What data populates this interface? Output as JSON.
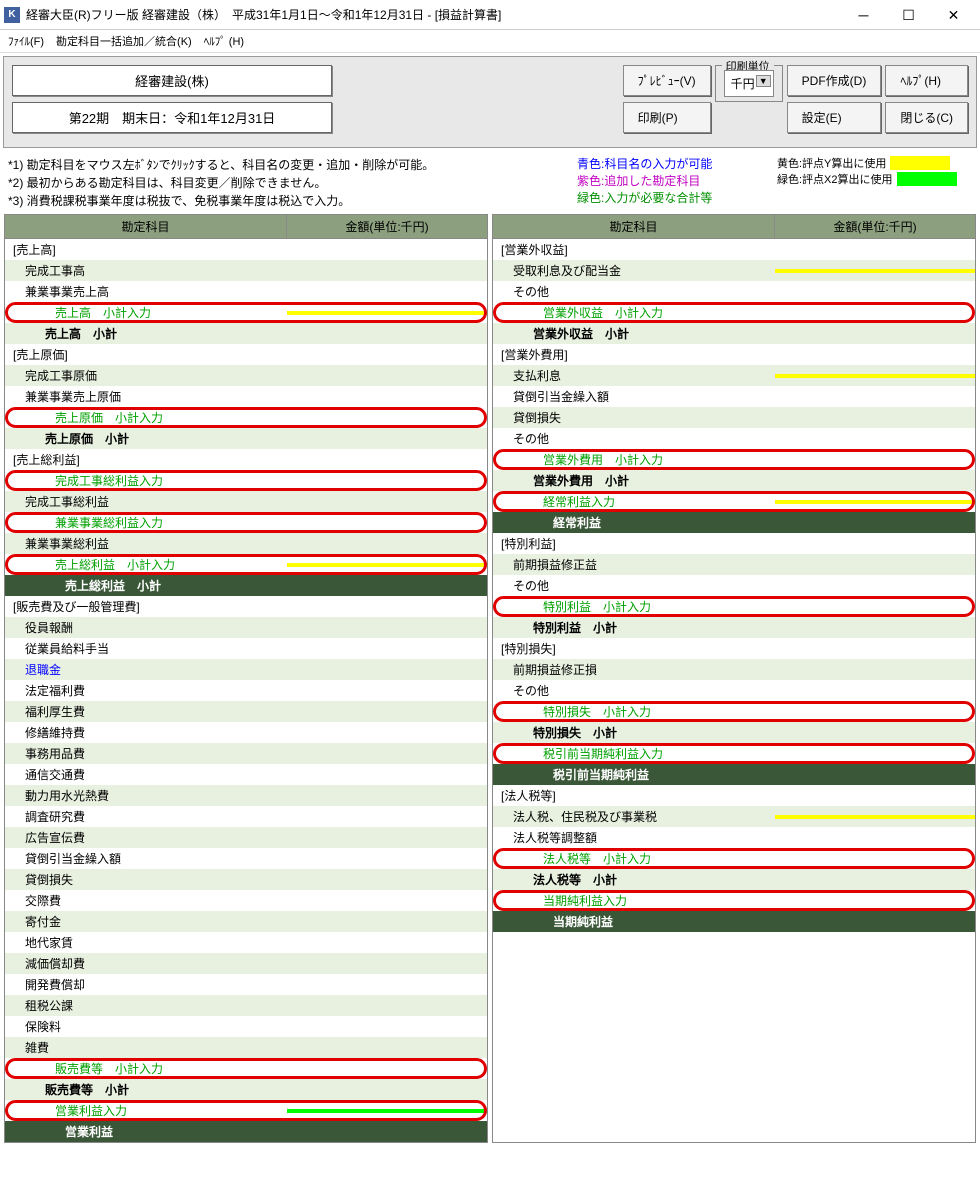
{
  "window": {
    "icon": "K",
    "title": "経審大臣(R)フリー版  経審建設（株）　平成31年1月1日～令和1年12月31日 - [損益計算書]"
  },
  "menu": {
    "file": "ﾌｧｲﾙ(F)",
    "addMerge": "勘定科目一括追加／統合(K)",
    "help": "ﾍﾙﾌﾟ (H)"
  },
  "info": {
    "company": "経審建設(株)",
    "period": "第22期　期末日：令和1年12月31日"
  },
  "buttons": {
    "preview": "ﾌﾟﾚﾋﾞｭｰ(V)",
    "print": "印刷(P)",
    "pdf": "PDF作成(D)",
    "settings": "設定(E)",
    "help": "ﾍﾙﾌﾟ(H)",
    "close": "閉じる(C)"
  },
  "unit": {
    "label": "印刷単位",
    "value": "千円"
  },
  "notes": {
    "n1": "*1) 勘定科目をマウス左ﾎﾞﾀﾝでｸﾘｯｸすると、科目名の変更・追加・削除が可能。",
    "n2": "*2) 最初からある勘定科目は、科目変更／削除できません。",
    "n3": "*3) 消費税課税事業年度は税抜で、免税事業年度は税込で入力。",
    "blue": "青色:科目名の入力が可能",
    "purple": "紫色:追加した勘定科目",
    "green": "緑色:入力が必要な合計等",
    "yellowLbl": "黄色:評点Y算出に使用",
    "greenLbl": "緑色:評点X2算出に使用"
  },
  "headers": {
    "name": "勘定科目",
    "amt": "金額(単位:千円)"
  },
  "left": [
    {
      "t": "s",
      "txt": "[売上高]"
    },
    {
      "t": "i",
      "txt": "完成工事高",
      "alt": 1
    },
    {
      "t": "i",
      "txt": "兼業事業売上高"
    },
    {
      "t": "hl",
      "txt": "売上高　小計入力",
      "amt": "y"
    },
    {
      "t": "sub",
      "txt": "売上高　小計"
    },
    {
      "t": "s",
      "txt": "[売上原価]"
    },
    {
      "t": "i",
      "txt": "完成工事原価",
      "alt": 1
    },
    {
      "t": "i",
      "txt": "兼業事業売上原価"
    },
    {
      "t": "hl",
      "txt": "売上原価　小計入力"
    },
    {
      "t": "sub",
      "txt": "売上原価　小計"
    },
    {
      "t": "s",
      "txt": "[売上総利益]"
    },
    {
      "t": "hl",
      "txt": "完成工事総利益入力"
    },
    {
      "t": "i",
      "txt": "完成工事総利益",
      "alt": 1
    },
    {
      "t": "hl",
      "txt": "兼業事業総利益入力"
    },
    {
      "t": "i",
      "txt": "兼業事業総利益",
      "alt": 1
    },
    {
      "t": "hl",
      "txt": "売上総利益　小計入力",
      "amt": "y"
    },
    {
      "t": "dark",
      "txt": "売上総利益　小計"
    },
    {
      "t": "s",
      "txt": "[販売費及び一般管理費]"
    },
    {
      "t": "i",
      "txt": "役員報酬",
      "alt": 1
    },
    {
      "t": "i",
      "txt": "従業員給料手当"
    },
    {
      "t": "i",
      "txt": "退職金",
      "alt": 1,
      "cls": "txt-blue"
    },
    {
      "t": "i",
      "txt": "法定福利費"
    },
    {
      "t": "i",
      "txt": "福利厚生費",
      "alt": 1
    },
    {
      "t": "i",
      "txt": "修繕維持費"
    },
    {
      "t": "i",
      "txt": "事務用品費",
      "alt": 1
    },
    {
      "t": "i",
      "txt": "通信交通費"
    },
    {
      "t": "i",
      "txt": "動力用水光熱費",
      "alt": 1
    },
    {
      "t": "i",
      "txt": "調査研究費"
    },
    {
      "t": "i",
      "txt": "広告宣伝費",
      "alt": 1
    },
    {
      "t": "i",
      "txt": "貸倒引当金繰入額"
    },
    {
      "t": "i",
      "txt": "貸倒損失",
      "alt": 1
    },
    {
      "t": "i",
      "txt": "交際費"
    },
    {
      "t": "i",
      "txt": "寄付金",
      "alt": 1
    },
    {
      "t": "i",
      "txt": "地代家賃"
    },
    {
      "t": "i",
      "txt": "減価償却費",
      "alt": 1
    },
    {
      "t": "i",
      "txt": "開発費償却"
    },
    {
      "t": "i",
      "txt": "租税公課",
      "alt": 1
    },
    {
      "t": "i",
      "txt": "保険料"
    },
    {
      "t": "i",
      "txt": "雑費",
      "alt": 1
    },
    {
      "t": "hl",
      "txt": "販売費等　小計入力"
    },
    {
      "t": "sub",
      "txt": "販売費等　小計"
    },
    {
      "t": "hl",
      "txt": "営業利益入力",
      "amt": "g"
    },
    {
      "t": "dark",
      "txt": "営業利益"
    }
  ],
  "right": [
    {
      "t": "s",
      "txt": "[営業外収益]"
    },
    {
      "t": "i",
      "txt": "受取利息及び配当金",
      "alt": 1,
      "amt": "y"
    },
    {
      "t": "i",
      "txt": "その他"
    },
    {
      "t": "hl",
      "txt": "営業外収益　小計入力"
    },
    {
      "t": "sub",
      "txt": "営業外収益　小計"
    },
    {
      "t": "s",
      "txt": "[営業外費用]"
    },
    {
      "t": "i",
      "txt": "支払利息",
      "alt": 1,
      "amt": "y"
    },
    {
      "t": "i",
      "txt": "貸倒引当金繰入額"
    },
    {
      "t": "i",
      "txt": "貸倒損失",
      "alt": 1
    },
    {
      "t": "i",
      "txt": "その他"
    },
    {
      "t": "hl",
      "txt": "営業外費用　小計入力"
    },
    {
      "t": "sub",
      "txt": "営業外費用　小計"
    },
    {
      "t": "hl",
      "txt": "経常利益入力",
      "amt": "y"
    },
    {
      "t": "dark",
      "txt": "経常利益"
    },
    {
      "t": "s",
      "txt": "[特別利益]"
    },
    {
      "t": "i",
      "txt": "前期損益修正益",
      "alt": 1
    },
    {
      "t": "i",
      "txt": "その他"
    },
    {
      "t": "hl",
      "txt": "特別利益　小計入力"
    },
    {
      "t": "sub",
      "txt": "特別利益　小計"
    },
    {
      "t": "s",
      "txt": "[特別損失]"
    },
    {
      "t": "i",
      "txt": "前期損益修正損",
      "alt": 1
    },
    {
      "t": "i",
      "txt": "その他"
    },
    {
      "t": "hl",
      "txt": "特別損失　小計入力"
    },
    {
      "t": "sub",
      "txt": "特別損失　小計"
    },
    {
      "t": "hl",
      "txt": "税引前当期純利益入力"
    },
    {
      "t": "dark",
      "txt": "税引前当期純利益"
    },
    {
      "t": "s",
      "txt": "[法人税等]"
    },
    {
      "t": "i",
      "txt": "法人税、住民税及び事業税",
      "alt": 1,
      "amt": "y"
    },
    {
      "t": "i",
      "txt": "法人税等調整額"
    },
    {
      "t": "hl",
      "txt": "法人税等　小計入力"
    },
    {
      "t": "sub",
      "txt": "法人税等　小計"
    },
    {
      "t": "hl",
      "txt": "当期純利益入力"
    },
    {
      "t": "dark",
      "txt": "当期純利益"
    }
  ]
}
